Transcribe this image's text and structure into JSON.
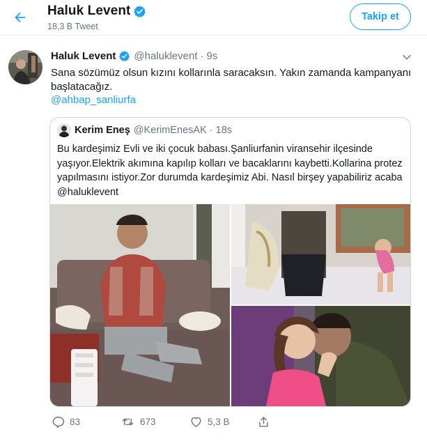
{
  "header": {
    "title": "Haluk Levent",
    "tweet_count": "18,3 B Tweet",
    "follow_label": "Takip et"
  },
  "tweet": {
    "author_name": "Haluk Levent",
    "author_handle": "@haluklevent",
    "dot": "·",
    "time": "9s",
    "text": "Sana sözümüz olsun kızını kollarınla saracaksın. Yakın zamanda kampanyanı başlatacağız.",
    "mention": "@ahbap_sanliurfa",
    "quote": {
      "author_name": "Kerim Eneş",
      "author_handle": "@KerimEnesAK",
      "time": "18s",
      "text": "Bu kardeşimiz Evli ve iki çocuk babası.Şanliurfanin viransehir ilçesinde yaşıyor.Elektrik akımına kapılıp kolları ve bacaklarını kaybetti.Kollarina protez yapılmasını istiyor.Zor durumda kardeşimiz Abi. Nasıl birşey yapabiliriz acaba @haluklevent"
    },
    "actions": {
      "reply_count": "83",
      "retweet_count": "673",
      "like_count": "5,3 B"
    }
  },
  "colors": {
    "accent": "#1da1f2",
    "secondary_text": "#657786",
    "border": "#ccd6dd"
  },
  "icons": [
    "back-arrow-icon",
    "verified-badge-icon",
    "chevron-down-icon",
    "reply-icon",
    "retweet-icon",
    "like-icon",
    "share-icon"
  ]
}
